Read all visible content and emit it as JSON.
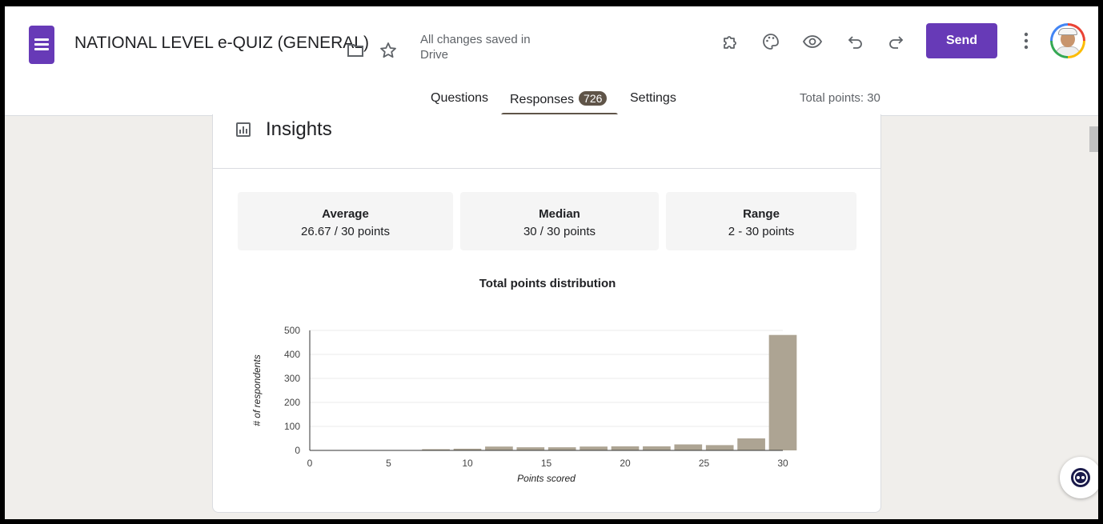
{
  "header": {
    "form_title": "NATIONAL LEVEL e-QUIZ (GENERAL)",
    "save_status": "All changes saved in Drive",
    "send_label": "Send"
  },
  "tabs": {
    "questions": "Questions",
    "responses": "Responses",
    "responses_count": "726",
    "settings": "Settings",
    "total_points": "Total points: 30"
  },
  "insights": {
    "title": "Insights",
    "stats": [
      {
        "label": "Average",
        "value": "26.67 / 30 points"
      },
      {
        "label": "Median",
        "value": "30 / 30 points"
      },
      {
        "label": "Range",
        "value": "2 - 30 points"
      }
    ]
  },
  "chart_data": {
    "type": "bar",
    "title": "Total points distribution",
    "xlabel": "Points scored",
    "ylabel": "# of respondents",
    "x": [
      2,
      4,
      6,
      8,
      10,
      12,
      14,
      16,
      18,
      20,
      22,
      24,
      26,
      28,
      30
    ],
    "values": [
      1,
      1,
      1,
      5,
      7,
      16,
      13,
      13,
      16,
      17,
      17,
      25,
      22,
      50,
      481
    ],
    "xlim": [
      0,
      30
    ],
    "ylim": [
      0,
      500
    ],
    "xticks": [
      0,
      5,
      10,
      15,
      20,
      25,
      30
    ],
    "yticks": [
      0,
      100,
      200,
      300,
      400,
      500
    ],
    "grid": true,
    "color": "#ada493"
  },
  "colors": {
    "brand": "#673ab7",
    "bar": "#ada493",
    "badge": "#5f5448"
  }
}
